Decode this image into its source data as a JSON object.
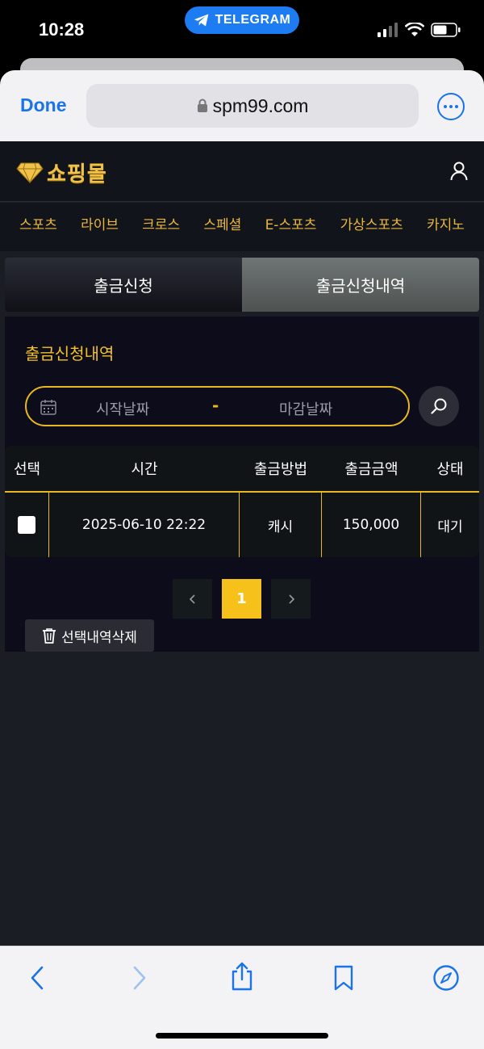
{
  "status_bar": {
    "time": "10:28",
    "pill_label": "TELEGRAM"
  },
  "browser": {
    "done_label": "Done",
    "url": "spm99.com"
  },
  "site": {
    "logo_text": "쇼핑몰",
    "nav": [
      "스포츠",
      "라이브",
      "크로스",
      "스페셜",
      "E-스포츠",
      "가상스포츠",
      "카지노"
    ],
    "tabs": [
      "출금신청",
      "출금신청내역"
    ],
    "panel_title": "출금신청내역",
    "date_start_placeholder": "시작날짜",
    "date_separator": "-",
    "date_end_placeholder": "마감날짜",
    "table": {
      "headers": [
        "선택",
        "시간",
        "출금방법",
        "출금금액",
        "상태"
      ],
      "rows": [
        {
          "time": "2025-06-10 22:22",
          "method": "캐시",
          "amount": "150,000",
          "status": "대기"
        }
      ]
    },
    "pagination": {
      "current_page": "1"
    },
    "delete_label": "선택내역삭제"
  },
  "colors": {
    "accent_gold": "#e8b820",
    "ios_blue": "#1a73e8",
    "telegram_blue": "#1d7cf2"
  },
  "icons": [
    "telegram-icon",
    "signal-icon",
    "wifi-icon",
    "battery-icon",
    "lock-icon",
    "more-icon",
    "diamond-icon",
    "user-icon",
    "calendar-icon",
    "search-icon",
    "chevron-left-icon",
    "chevron-right-icon",
    "trash-icon",
    "back-icon",
    "forward-icon",
    "share-icon",
    "bookmark-icon",
    "compass-icon"
  ]
}
